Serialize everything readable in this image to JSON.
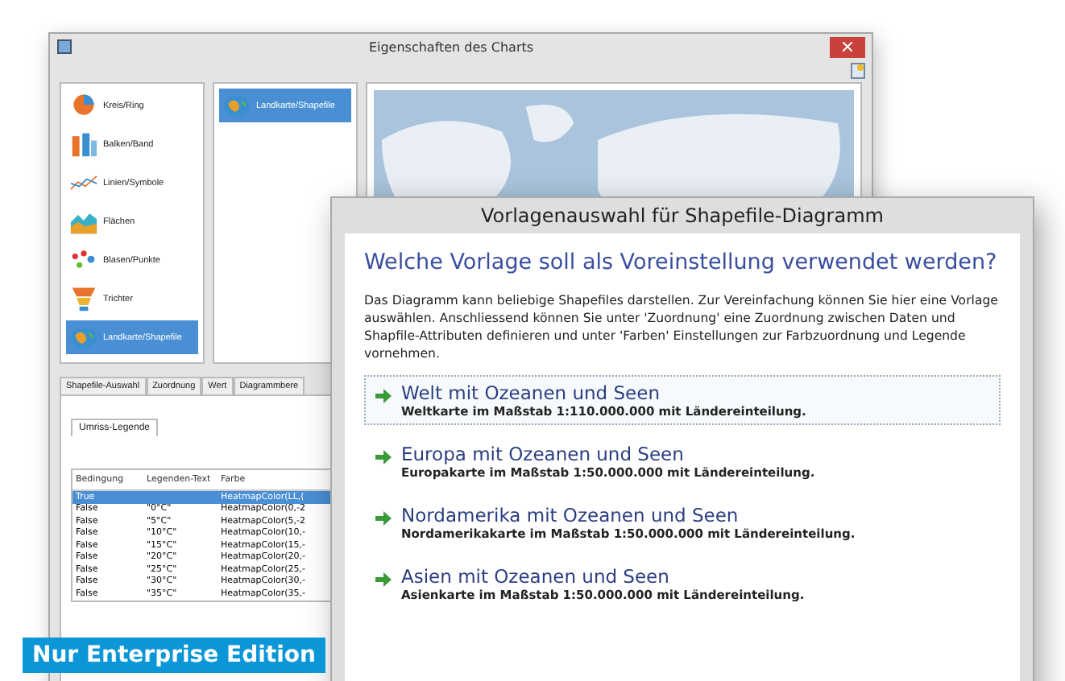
{
  "back_window": {
    "title": "Eigenschaften des Charts",
    "chart_types": [
      {
        "label": "Kreis/Ring",
        "kind": "pie",
        "selected": false
      },
      {
        "label": "Balken/Band",
        "kind": "bar",
        "selected": false
      },
      {
        "label": "Linien/Symbole",
        "kind": "line",
        "selected": false
      },
      {
        "label": "Flächen",
        "kind": "area",
        "selected": false
      },
      {
        "label": "Blasen/Punkte",
        "kind": "bubble",
        "selected": false
      },
      {
        "label": "Trichter",
        "kind": "funnel",
        "selected": false
      },
      {
        "label": "Landkarte/Shapefile",
        "kind": "map",
        "selected": true
      }
    ],
    "subtypes": [
      {
        "label": "Landkarte/Shapefile",
        "selected": true
      }
    ],
    "tabs": [
      {
        "label": "Shapefile-Auswahl",
        "selected": false
      },
      {
        "label": "Zuordnung",
        "selected": false
      },
      {
        "label": "Wert",
        "selected": false
      },
      {
        "label": "Diagrammbere",
        "selected": false
      }
    ],
    "subtabs": [
      {
        "label": "Umriss-Legende",
        "selected": true
      }
    ],
    "table": {
      "columns": [
        "Bedingung",
        "Legenden-Text",
        "Farbe"
      ],
      "rows": [
        {
          "cells": [
            "True",
            "",
            "HeatmapColor(LL,("
          ],
          "selected": true
        },
        {
          "cells": [
            "False",
            "\"0°C\"",
            "HeatmapColor(0,-2"
          ],
          "selected": false
        },
        {
          "cells": [
            "False",
            "\"5°C\"",
            "HeatmapColor(5,-2"
          ],
          "selected": false
        },
        {
          "cells": [
            "False",
            "\"10°C\"",
            "HeatmapColor(10,-"
          ],
          "selected": false
        },
        {
          "cells": [
            "False",
            "\"15°C\"",
            "HeatmapColor(15,-"
          ],
          "selected": false
        },
        {
          "cells": [
            "False",
            "\"20°C\"",
            "HeatmapColor(20,-"
          ],
          "selected": false
        },
        {
          "cells": [
            "False",
            "\"25°C\"",
            "HeatmapColor(25,-"
          ],
          "selected": false
        },
        {
          "cells": [
            "False",
            "\"30°C\"",
            "HeatmapColor(30,-"
          ],
          "selected": false
        },
        {
          "cells": [
            "False",
            "\"35°C\"",
            "HeatmapColor(35,-"
          ],
          "selected": false
        }
      ]
    }
  },
  "dialog": {
    "title": "Vorlagenauswahl für Shapefile-Diagramm",
    "heading": "Welche Vorlage soll als Voreinstellung verwendet werden?",
    "description": "Das Diagramm kann beliebige Shapefiles darstellen. Zur Vereinfachung können Sie hier eine Vorlage auswählen. Anschliessend können Sie unter 'Zuordnung' eine Zuordnung zwischen Daten und Shapfile-Attributen definieren und unter 'Farben' Einstellungen zur Farbzuordnung und Legende vornehmen.",
    "options": [
      {
        "title": "Welt mit Ozeanen und Seen",
        "subtitle": "Weltkarte im Maßstab 1:110.000.000 mit Ländereinteilung.",
        "selected": true
      },
      {
        "title": "Europa mit Ozeanen und Seen",
        "subtitle": "Europakarte im Maßstab 1:50.000.000 mit Ländereinteilung.",
        "selected": false
      },
      {
        "title": "Nordamerika mit Ozeanen und Seen",
        "subtitle": "Nordamerikakarte im Maßstab 1:50.000.000 mit Ländereinteilung.",
        "selected": false
      },
      {
        "title": "Asien mit Ozeanen und Seen",
        "subtitle": "Asienkarte im Maßstab 1:50.000.000 mit Ländereinteilung.",
        "selected": false
      }
    ]
  },
  "badge": "Nur Enterprise Edition"
}
